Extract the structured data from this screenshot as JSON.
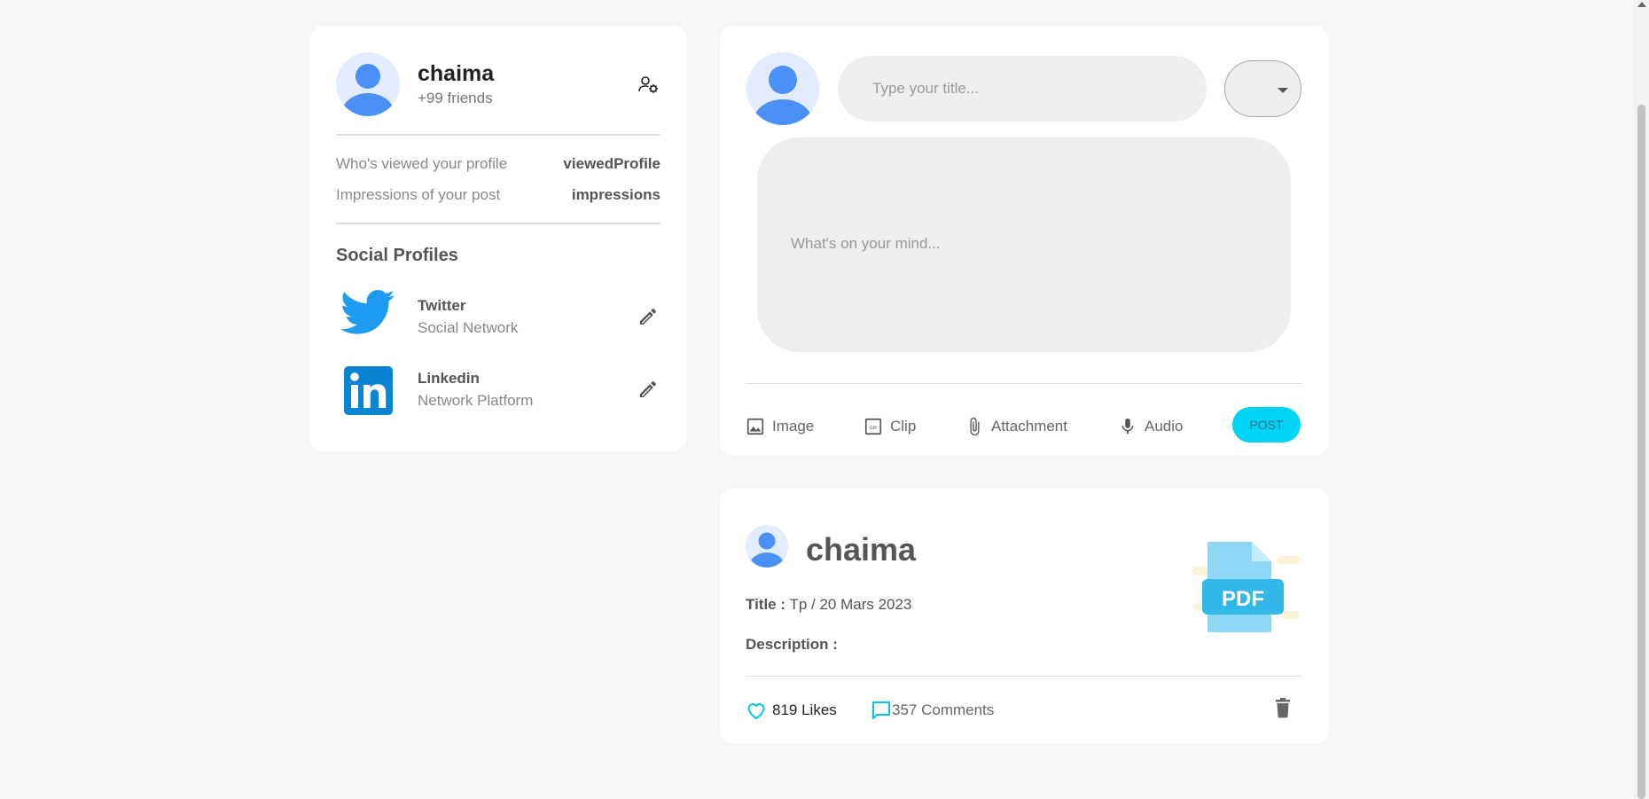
{
  "profile": {
    "name": "chaima",
    "friends": "+99 friends",
    "stats": [
      {
        "label": "Who's viewed your profile",
        "value": "viewedProfile"
      },
      {
        "label": "Impressions of your post",
        "value": "impressions"
      }
    ],
    "social_title": "Social Profiles",
    "social": [
      {
        "name": "Twitter",
        "sub": "Social Network",
        "icon": "twitter-icon"
      },
      {
        "name": "Linkedin",
        "sub": "Network Platform",
        "icon": "linkedin-icon"
      }
    ]
  },
  "composer": {
    "title_placeholder": "Type your title...",
    "body_placeholder": "What's on your mind...",
    "actions": [
      {
        "label": "Image",
        "icon": "image-icon"
      },
      {
        "label": "Clip",
        "icon": "gif-icon"
      },
      {
        "label": "Attachment",
        "icon": "paperclip-icon"
      },
      {
        "label": "Audio",
        "icon": "microphone-icon"
      }
    ],
    "post_label": "POST"
  },
  "post": {
    "author": "chaima",
    "title_label": "Title :",
    "title_value": "Tp / 20 Mars 2023",
    "description_label": "Description :",
    "attachment_icon": "pdf-file-icon",
    "attachment_label": "PDF",
    "likes": "819 Likes",
    "comments": "357 Comments"
  },
  "colors": {
    "accent": "#00d4f5",
    "avatar_blue": "#4a90f7",
    "avatar_bg": "#e3ecfd",
    "twitter_blue": "#1d9bf0",
    "linkedin_blue": "#0a85d1"
  }
}
